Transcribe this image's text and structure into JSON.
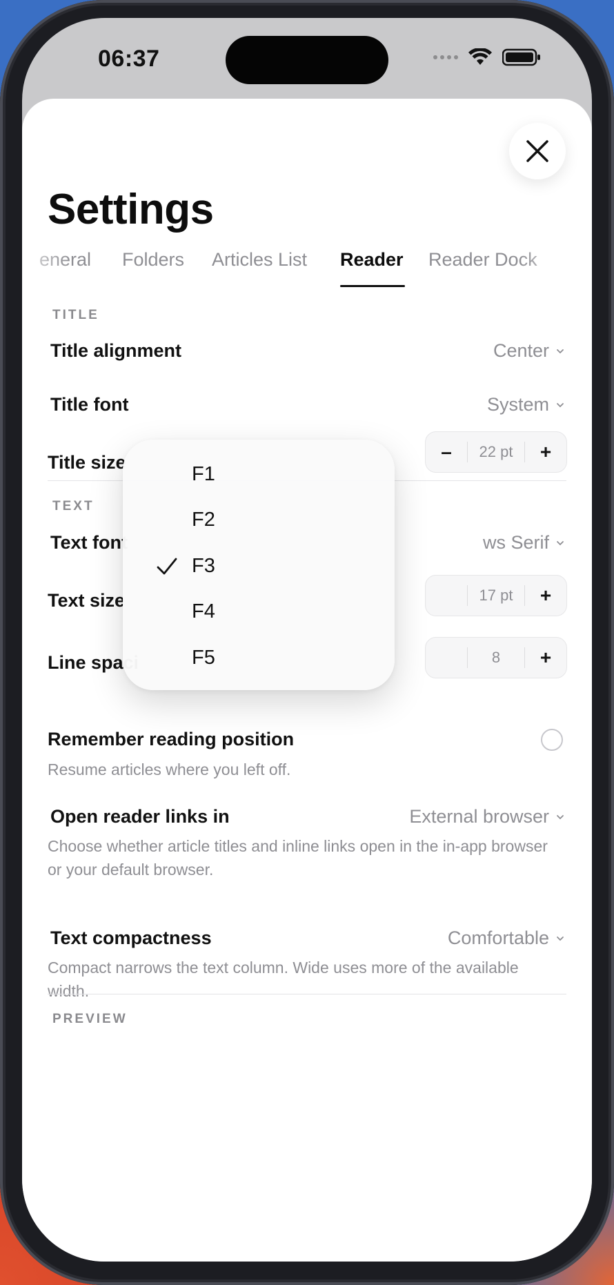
{
  "status_bar": {
    "time": "06:37"
  },
  "page": {
    "title": "Settings"
  },
  "tabs": [
    {
      "label": "eneral",
      "active": false
    },
    {
      "label": "Folders",
      "active": false
    },
    {
      "label": "Articles List",
      "active": false
    },
    {
      "label": "Reader",
      "active": true
    },
    {
      "label": "Reader Dock",
      "active": false
    }
  ],
  "title_section": {
    "label": "TITLE",
    "alignment": {
      "label": "Title alignment",
      "value": "Center"
    },
    "font": {
      "label": "Title font",
      "value": "System"
    },
    "size": {
      "label": "Title size",
      "minus": "–",
      "value": "22 pt",
      "plus": "+"
    }
  },
  "text_section": {
    "label": "TEXT",
    "font": {
      "label": "Text font",
      "value": "ws Serif"
    },
    "size": {
      "label": "Text size",
      "value": "17 pt",
      "plus": "+"
    },
    "line_spacing": {
      "label": "Line spaci",
      "value": "8",
      "plus": "+"
    }
  },
  "dropdown": {
    "options": [
      "F1",
      "F2",
      "F3",
      "F4",
      "F5"
    ],
    "selected": "F3"
  },
  "reading": {
    "remember": {
      "label": "Remember reading position",
      "helper": "Resume articles where you left off."
    },
    "links": {
      "label": "Open reader links in",
      "value": "External browser",
      "helper": "Choose whether article titles and inline links open in the in-app browser or your default browser."
    },
    "compactness": {
      "label": "Text compactness",
      "value": "Comfortable",
      "helper": "Compact narrows the text column. Wide uses more of the available width."
    }
  },
  "preview": {
    "label": "PREVIEW"
  },
  "colors": {
    "accent": "#0d0d0d",
    "secondary_text": "#8e8e93",
    "sheet": "#ffffff"
  }
}
